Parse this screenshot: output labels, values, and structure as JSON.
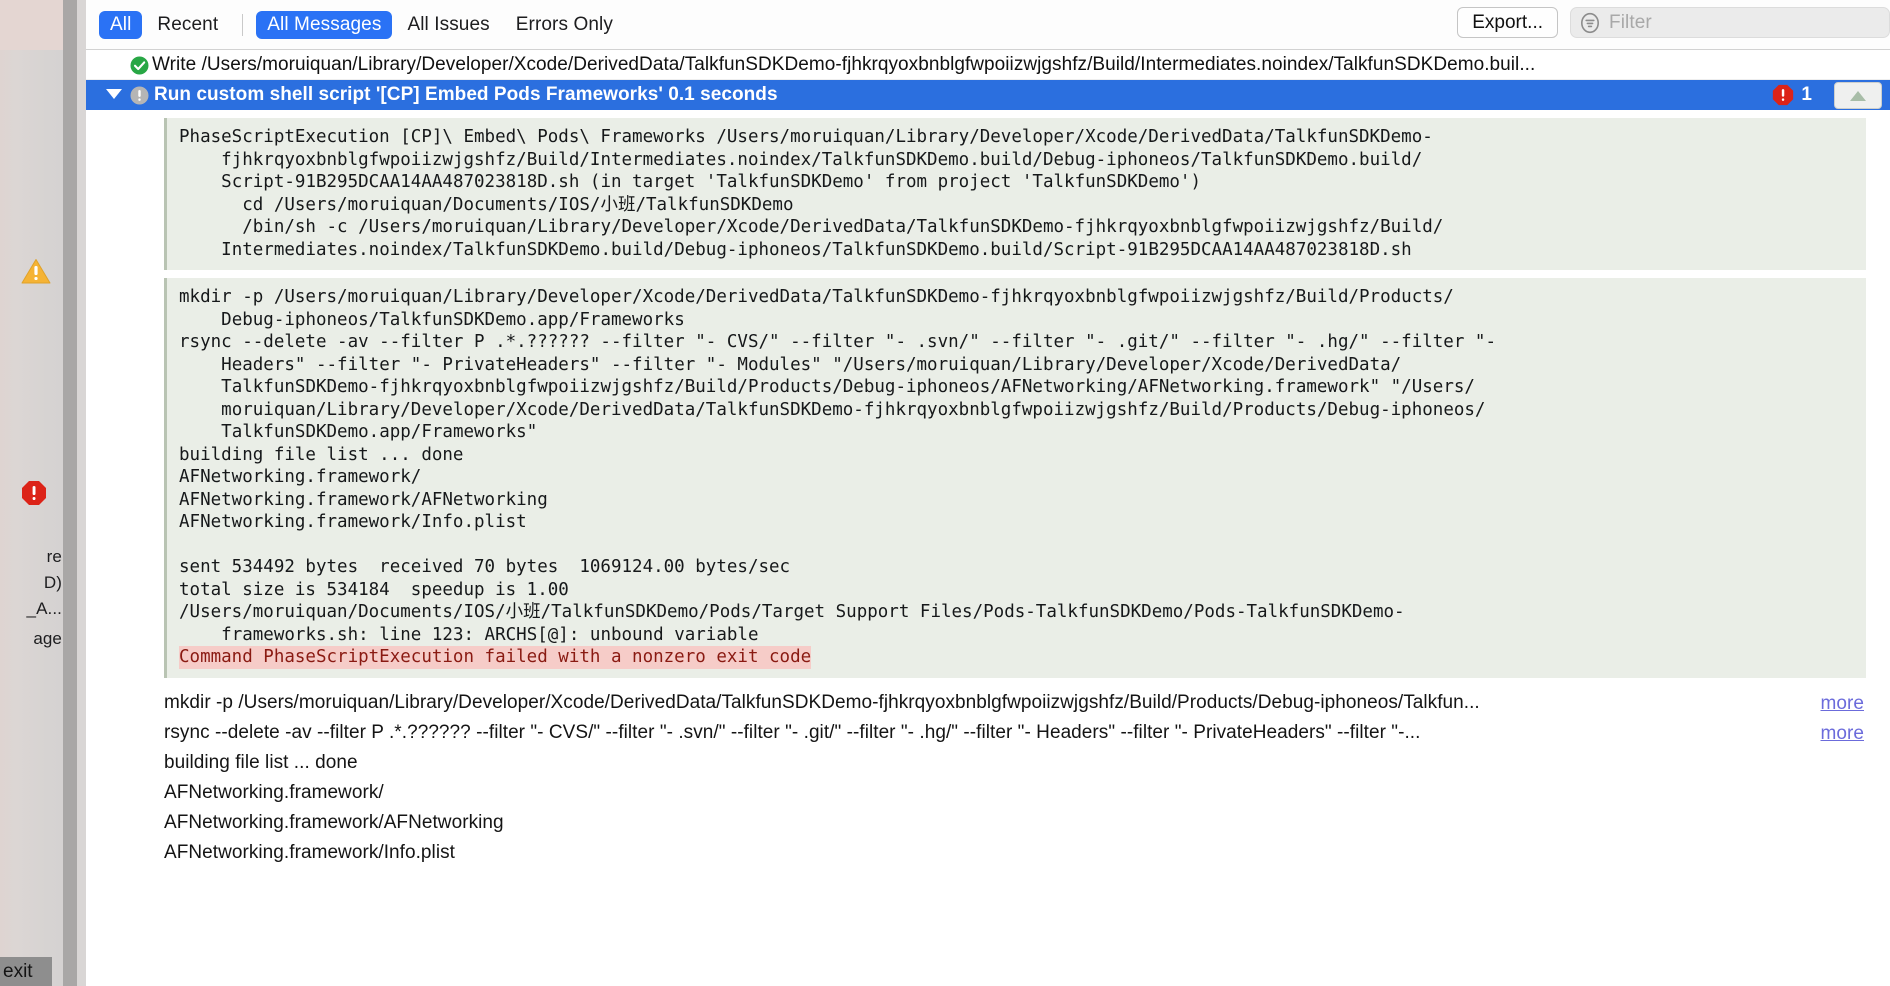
{
  "toolbar": {
    "segments_left": [
      {
        "label": "All",
        "selected": true
      },
      {
        "label": "Recent",
        "selected": false
      }
    ],
    "segments_right": [
      {
        "label": "All Messages",
        "selected": true
      },
      {
        "label": "All Issues",
        "selected": false
      },
      {
        "label": "Errors Only",
        "selected": false
      }
    ],
    "export_label": "Export...",
    "filter_placeholder": "Filter",
    "filter_value": "",
    "filter_icon": "filter-icon",
    "accent_color": "#2a72f5"
  },
  "gutter": {
    "warning_icon": "warning-triangle-icon",
    "error_icon": "error-octagon-icon",
    "clipped_lines": [
      "re",
      "D)",
      "_A...",
      "age"
    ],
    "exit_label": "exit"
  },
  "rows": [
    {
      "id": "write-row",
      "status_icon": "success-check-icon",
      "text": "Write /Users/moruiquan/Library/Developer/Xcode/DerivedData/TalkfunSDKDemo-fjhkrqyoxbnblgfwpoiizwjgshfz/Build/Intermediates.noindex/TalkfunSDKDemo.buil..."
    },
    {
      "id": "script-row",
      "status_icon": "warning-circle-icon",
      "disclosure": "expanded",
      "text": "Run custom shell script '[CP] Embed Pods Frameworks'  0.1 seconds",
      "error_count": "1",
      "error_badge_icon": "error-octagon-icon",
      "scroll_up_icon": "triangle-up-icon"
    }
  ],
  "console_block_1": "PhaseScriptExecution [CP]\\ Embed\\ Pods\\ Frameworks /Users/moruiquan/Library/Developer/Xcode/DerivedData/TalkfunSDKDemo-\n    fjhkrqyoxbnblgfwpoiizwjgshfz/Build/Intermediates.noindex/TalkfunSDKDemo.build/Debug-iphoneos/TalkfunSDKDemo.build/\n    Script-91B295DCAA14AA487023818D.sh (in target 'TalkfunSDKDemo' from project 'TalkfunSDKDemo')\n      cd /Users/moruiquan/Documents/IOS/小班/TalkfunSDKDemo\n      /bin/sh -c /Users/moruiquan/Library/Developer/Xcode/DerivedData/TalkfunSDKDemo-fjhkrqyoxbnblgfwpoiizwjgshfz/Build/\n    Intermediates.noindex/TalkfunSDKDemo.build/Debug-iphoneos/TalkfunSDKDemo.build/Script-91B295DCAA14AA487023818D.sh",
  "console_block_2_pre": "mkdir -p /Users/moruiquan/Library/Developer/Xcode/DerivedData/TalkfunSDKDemo-fjhkrqyoxbnblgfwpoiizwjgshfz/Build/Products/\n    Debug-iphoneos/TalkfunSDKDemo.app/Frameworks\nrsync --delete -av --filter P .*.?????? --filter \"- CVS/\" --filter \"- .svn/\" --filter \"- .git/\" --filter \"- .hg/\" --filter \"-\n    Headers\" --filter \"- PrivateHeaders\" --filter \"- Modules\" \"/Users/moruiquan/Library/Developer/Xcode/DerivedData/\n    TalkfunSDKDemo-fjhkrqyoxbnblgfwpoiizwjgshfz/Build/Products/Debug-iphoneos/AFNetworking/AFNetworking.framework\" \"/Users/\n    moruiquan/Library/Developer/Xcode/DerivedData/TalkfunSDKDemo-fjhkrqyoxbnblgfwpoiizwjgshfz/Build/Products/Debug-iphoneos/\n    TalkfunSDKDemo.app/Frameworks\"\nbuilding file list ... done\nAFNetworking.framework/\nAFNetworking.framework/AFNetworking\nAFNetworking.framework/Info.plist\n\nsent 534492 bytes  received 70 bytes  1069124.00 bytes/sec\ntotal size is 534184  speedup is 1.00\n/Users/moruiquan/Documents/IOS/小班/TalkfunSDKDemo/Pods/Target Support Files/Pods-TalkfunSDKDemo/Pods-TalkfunSDKDemo-\n    frameworks.sh: line 123: ARCHS[@]: unbound variable\n",
  "console_block_2_error": "Command PhaseScriptExecution failed with a nonzero exit code",
  "bottom_rows": [
    {
      "text": "mkdir -p /Users/moruiquan/Library/Developer/Xcode/DerivedData/TalkfunSDKDemo-fjhkrqyoxbnblgfwpoiizwjgshfz/Build/Products/Debug-iphoneos/Talkfun...",
      "more": "more"
    },
    {
      "text": "rsync --delete -av --filter P .*.?????? --filter \"- CVS/\" --filter \"- .svn/\" --filter \"- .git/\" --filter \"- .hg/\" --filter \"- Headers\" --filter \"- PrivateHeaders\" --filter \"-...",
      "more": "more"
    },
    {
      "text": "building file list ... done",
      "more": ""
    },
    {
      "text": "AFNetworking.framework/",
      "more": ""
    },
    {
      "text": "AFNetworking.framework/AFNetworking",
      "more": ""
    },
    {
      "text": "AFNetworking.framework/Info.plist",
      "more": ""
    }
  ],
  "colors": {
    "console_bg": "#eaeee7",
    "error_highlight": "#f6ccc8",
    "error_text": "#8a1a12",
    "selection_blue": "#2b6fdf",
    "link": "#6b6bdb"
  }
}
